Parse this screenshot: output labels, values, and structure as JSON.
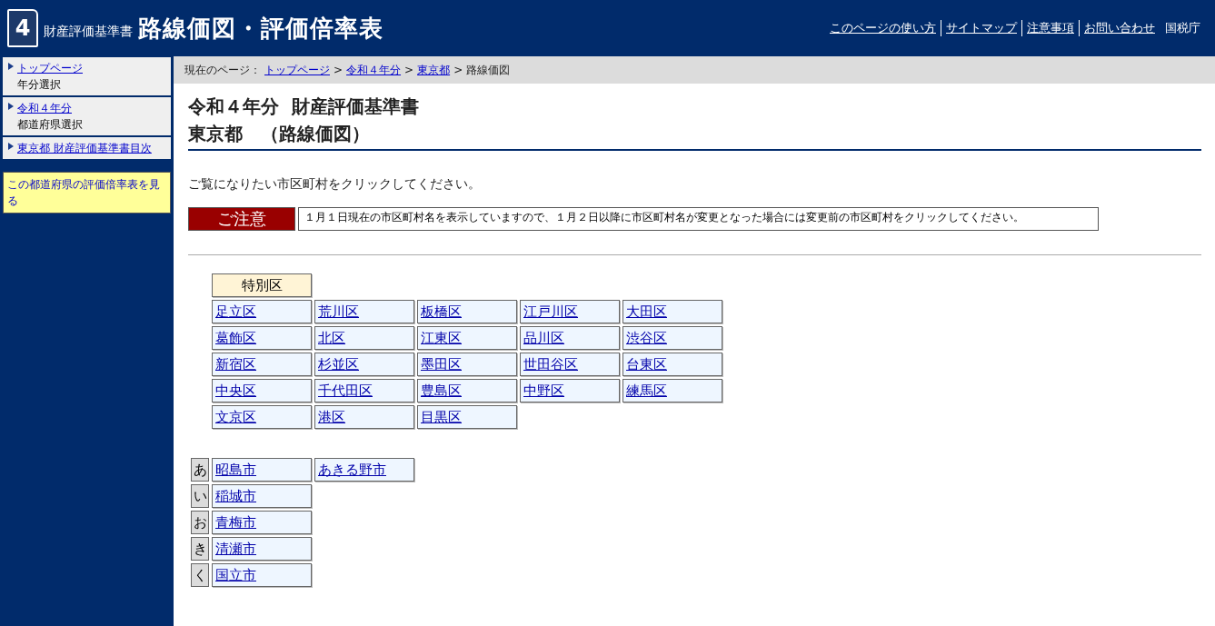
{
  "header": {
    "logo_number": "4",
    "subtitle": "財産評価基準書",
    "title": "路線価図・評価倍率表",
    "links": [
      "このページの使い方",
      "サイトマップ",
      "注意事項",
      "お問い合わせ"
    ],
    "agency": "国税庁"
  },
  "sidebar": {
    "items": [
      {
        "link": "トップページ",
        "caption": "年分選択"
      },
      {
        "link": "令和４年分",
        "caption": "都道府県選択"
      },
      {
        "link": "東京都  財産評価基準書目次"
      }
    ],
    "callout": "この都道府県の評価倍率表を見る"
  },
  "breadcrumb": {
    "label": "現在のページ：",
    "links": [
      "トップページ",
      "令和４年分",
      "東京都"
    ],
    "separators": [
      ">",
      ">",
      ">"
    ],
    "current": "路線価図"
  },
  "heading": {
    "line1": "令和４年分  財産評価基準書",
    "line2": "東京都　（路線価図）"
  },
  "instruction": "ご覧になりたい市区町村をクリックしてください。",
  "notice": {
    "label": "ご注意",
    "text": "１月１日現在の市区町村名を表示していますので、１月２日以降に市区町村名が変更となった場合には変更前の市区町村をクリックしてください。"
  },
  "special_wards": {
    "heading": "特別区",
    "wards": [
      "足立区",
      "荒川区",
      "板橋区",
      "江戸川区",
      "大田区",
      "葛飾区",
      "北区",
      "江東区",
      "品川区",
      "渋谷区",
      "新宿区",
      "杉並区",
      "墨田区",
      "世田谷区",
      "台東区",
      "中央区",
      "千代田区",
      "豊島区",
      "中野区",
      "練馬区",
      "文京区",
      "港区",
      "目黒区"
    ]
  },
  "cities": [
    {
      "kana": "あ",
      "names": [
        "昭島市",
        "あきる野市"
      ]
    },
    {
      "kana": "い",
      "names": [
        "稲城市"
      ]
    },
    {
      "kana": "お",
      "names": [
        "青梅市"
      ]
    },
    {
      "kana": "き",
      "names": [
        "清瀬市"
      ]
    },
    {
      "kana": "く",
      "names": [
        "国立市"
      ]
    }
  ]
}
